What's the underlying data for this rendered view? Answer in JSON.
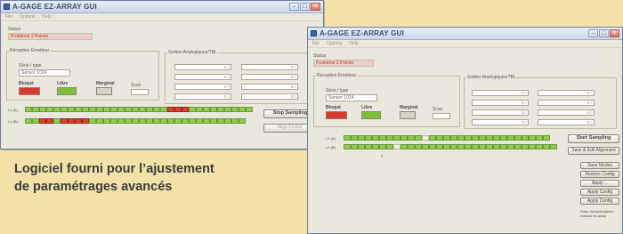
{
  "window_front_left": {
    "title": "A-GAGE EZ-ARRAY GUI",
    "menu": [
      "File",
      "Options",
      "Help"
    ],
    "status_label": "Status",
    "status_value": "Problème 3 Pointer",
    "emitter_label": "Réception Émetteur",
    "serial_label": "Série / type",
    "serial_value": "Sensor 1024",
    "blocked_label": "Bloqué",
    "clear_label": "Libre",
    "marginal_label": "Marginal",
    "scan_label": "Scan",
    "analog_label": "Sorties Analogiques/TBL",
    "row1_label": "L1 (A)",
    "row2_label": "L2 (B)",
    "button_stop": "Stop Sampling",
    "button_align": "Align Emitter"
  },
  "window_front_right": {
    "title": "A-GAGE EZ-ARRAY GUI",
    "menu": [
      "File",
      "Options",
      "Help"
    ],
    "status_label": "Status",
    "status_value": "Problème 3 Pointer",
    "emitter_label": "Réception Émetteur",
    "serial_label": "Série / type",
    "serial_value": "Sensor 1024",
    "blocked_label": "Bloqué",
    "clear_label": "Libre",
    "marginal_label": "Marginal",
    "scan_label": "Scan",
    "analog_label": "Sorties Analogiques/TBL",
    "row1_label": "L1 (A)",
    "row2_label": "L2 (B)",
    "button_start": "Start Sampling",
    "button_edit": "Save & Edit Alignment",
    "button_3": "Save Modes",
    "button_4": "Restore Config",
    "button_5": "Apply ...",
    "button_6": "Apply Config",
    "button_7": "Apply Config",
    "note": "Votre documentation: manual.ez-array"
  },
  "caption": {
    "line1": "Logiciel fourni pour l’ajustement",
    "line2": "de paramétrages avancés"
  },
  "colors": {
    "background": "#f3e3a9",
    "blocked": "#d8392b",
    "clear": "#7fbf3d",
    "status_text": "#c63621"
  }
}
